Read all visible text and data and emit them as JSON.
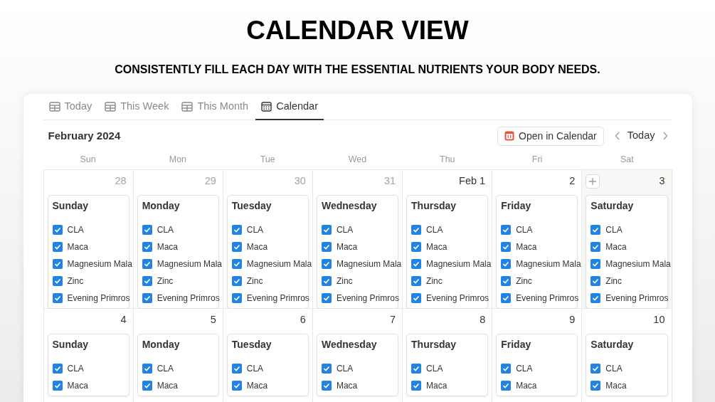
{
  "heading": {
    "title": "CALENDAR VIEW",
    "subtitle": "CONSISTENTLY FILL EACH DAY WITH THE ESSENTIAL NUTRIENTS YOUR BODY NEEDS."
  },
  "tabs": [
    {
      "label": "Today",
      "kind": "table",
      "selected": false
    },
    {
      "label": "This Week",
      "kind": "table",
      "selected": false
    },
    {
      "label": "This Month",
      "kind": "table",
      "selected": false
    },
    {
      "label": "Calendar",
      "kind": "calendar",
      "selected": true
    }
  ],
  "month": "February 2024",
  "open_button": "Open in Calendar",
  "today_button": "Today",
  "weekdays": [
    "Sun",
    "Mon",
    "Tue",
    "Wed",
    "Thu",
    "Fri",
    "Sat"
  ],
  "weeks": [
    {
      "days": [
        {
          "number": "28",
          "in_month": false,
          "hovered": false,
          "title": "Sunday",
          "items": [
            {
              "label": "CLA",
              "checked": true
            },
            {
              "label": "Maca",
              "checked": true
            },
            {
              "label": "Magnesium Mala",
              "checked": true
            },
            {
              "label": "Zinc",
              "checked": true
            },
            {
              "label": "Evening Primros",
              "checked": true
            }
          ]
        },
        {
          "number": "29",
          "in_month": false,
          "hovered": false,
          "title": "Monday",
          "items": [
            {
              "label": "CLA",
              "checked": true
            },
            {
              "label": "Maca",
              "checked": true
            },
            {
              "label": "Magnesium Mala",
              "checked": true
            },
            {
              "label": "Zinc",
              "checked": true
            },
            {
              "label": "Evening Primros",
              "checked": true
            }
          ]
        },
        {
          "number": "30",
          "in_month": false,
          "hovered": false,
          "title": "Tuesday",
          "items": [
            {
              "label": "CLA",
              "checked": true
            },
            {
              "label": "Maca",
              "checked": true
            },
            {
              "label": "Magnesium Mala",
              "checked": true
            },
            {
              "label": "Zinc",
              "checked": true
            },
            {
              "label": "Evening Primros",
              "checked": true
            }
          ]
        },
        {
          "number": "31",
          "in_month": false,
          "hovered": false,
          "title": "Wednesday",
          "items": [
            {
              "label": "CLA",
              "checked": true
            },
            {
              "label": "Maca",
              "checked": true
            },
            {
              "label": "Magnesium Mala",
              "checked": true
            },
            {
              "label": "Zinc",
              "checked": true
            },
            {
              "label": "Evening Primros",
              "checked": true
            }
          ]
        },
        {
          "number": "Feb 1",
          "in_month": true,
          "hovered": false,
          "title": "Thursday",
          "items": [
            {
              "label": "CLA",
              "checked": true
            },
            {
              "label": "Maca",
              "checked": true
            },
            {
              "label": "Magnesium Mala",
              "checked": true
            },
            {
              "label": "Zinc",
              "checked": true
            },
            {
              "label": "Evening Primros",
              "checked": true
            }
          ]
        },
        {
          "number": "2",
          "in_month": true,
          "hovered": false,
          "title": "Friday",
          "items": [
            {
              "label": "CLA",
              "checked": true
            },
            {
              "label": "Maca",
              "checked": true
            },
            {
              "label": "Magnesium Mala",
              "checked": true
            },
            {
              "label": "Zinc",
              "checked": true
            },
            {
              "label": "Evening Primros",
              "checked": true
            }
          ]
        },
        {
          "number": "3",
          "in_month": true,
          "hovered": true,
          "title": "Saturday",
          "items": [
            {
              "label": "CLA",
              "checked": true
            },
            {
              "label": "Maca",
              "checked": true
            },
            {
              "label": "Magnesium Mala",
              "checked": true
            },
            {
              "label": "Zinc",
              "checked": true
            },
            {
              "label": "Evening Primros",
              "checked": true
            }
          ]
        }
      ]
    },
    {
      "days": [
        {
          "number": "4",
          "in_month": true,
          "hovered": false,
          "title": "Sunday",
          "items": [
            {
              "label": "CLA",
              "checked": true
            },
            {
              "label": "Maca",
              "checked": true
            }
          ]
        },
        {
          "number": "5",
          "in_month": true,
          "hovered": false,
          "title": "Monday",
          "items": [
            {
              "label": "CLA",
              "checked": true
            },
            {
              "label": "Maca",
              "checked": true
            }
          ]
        },
        {
          "number": "6",
          "in_month": true,
          "hovered": false,
          "title": "Tuesday",
          "items": [
            {
              "label": "CLA",
              "checked": true
            },
            {
              "label": "Maca",
              "checked": true
            }
          ]
        },
        {
          "number": "7",
          "in_month": true,
          "hovered": false,
          "title": "Wednesday",
          "items": [
            {
              "label": "CLA",
              "checked": true
            },
            {
              "label": "Maca",
              "checked": true
            }
          ]
        },
        {
          "number": "8",
          "in_month": true,
          "hovered": false,
          "title": "Thursday",
          "items": [
            {
              "label": "CLA",
              "checked": true
            },
            {
              "label": "Maca",
              "checked": true
            }
          ]
        },
        {
          "number": "9",
          "in_month": true,
          "hovered": false,
          "title": "Friday",
          "items": [
            {
              "label": "CLA",
              "checked": true
            },
            {
              "label": "Maca",
              "checked": true
            }
          ]
        },
        {
          "number": "10",
          "in_month": true,
          "hovered": false,
          "title": "Saturday",
          "items": [
            {
              "label": "CLA",
              "checked": true
            },
            {
              "label": "Maca",
              "checked": true
            }
          ]
        }
      ]
    }
  ]
}
